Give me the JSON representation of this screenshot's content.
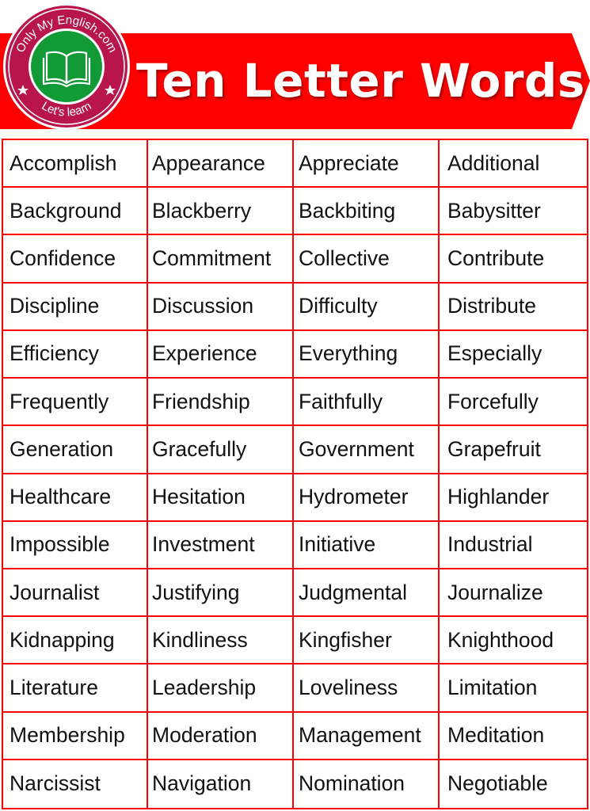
{
  "header": {
    "title": "Ten Letter Words",
    "banner_color": "#ff0000",
    "logo": {
      "top_text": "Only My English.com",
      "bottom_text": "Let's learn",
      "icon": "open-book-icon",
      "ring_color": "#b8154d",
      "inner_color": "#129a37",
      "star_icon": "star-icon"
    }
  },
  "table": {
    "border_color": "#ff0000",
    "rows": [
      [
        "Accomplish",
        "Appearance",
        "Appreciate",
        "Additional"
      ],
      [
        "Background",
        "Blackberry",
        "Backbiting",
        "Babysitter"
      ],
      [
        "Confidence",
        "Commitment",
        "Collective",
        "Contribute"
      ],
      [
        "Discipline",
        "Discussion",
        "Difficulty",
        "Distribute"
      ],
      [
        "Efficiency",
        "Experience",
        "Everything",
        "Especially"
      ],
      [
        "Frequently",
        "Friendship",
        "Faithfully",
        "Forcefully"
      ],
      [
        "Generation",
        "Gracefully",
        "Government",
        "Grapefruit"
      ],
      [
        "Healthcare",
        "Hesitation",
        "Hydrometer",
        "Highlander"
      ],
      [
        "Impossible",
        "Investment",
        "Initiative",
        "Industrial"
      ],
      [
        "Journalist",
        "Justifying",
        "Judgmental",
        "Journalize"
      ],
      [
        "Kidnapping",
        "Kindliness",
        "Kingfisher",
        "Knighthood"
      ],
      [
        "Literature",
        "Leadership",
        "Loveliness",
        "Limitation"
      ],
      [
        "Membership",
        "Moderation",
        "Management",
        "Meditation"
      ],
      [
        "Narcissist",
        "Navigation",
        "Nomination",
        "Negotiable"
      ]
    ]
  }
}
